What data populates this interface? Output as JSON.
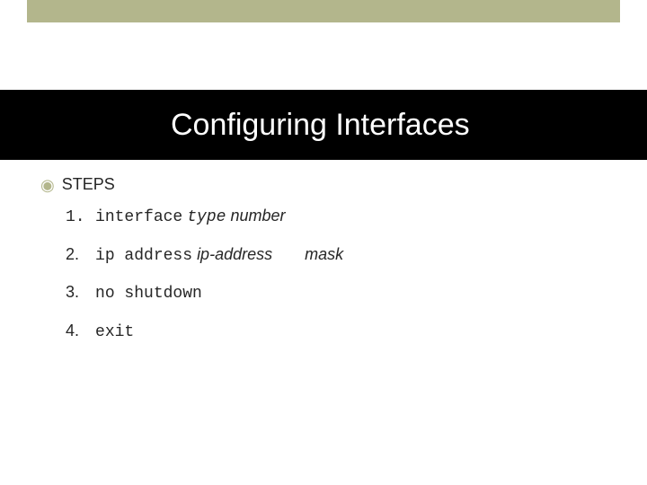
{
  "title": "Configuring Interfaces",
  "bullet": {
    "label": "STEPS"
  },
  "steps": {
    "s1": {
      "num": "1.",
      "cmd": "interface",
      "arg1": "type",
      "arg2": "number"
    },
    "s2": {
      "num": "2.",
      "cmd": "ip address",
      "arg1": "ip-address",
      "arg2": "mask"
    },
    "s3": {
      "num": "3.",
      "cmd": "no shutdown"
    },
    "s4": {
      "num": "4.",
      "cmd": "exit"
    }
  }
}
